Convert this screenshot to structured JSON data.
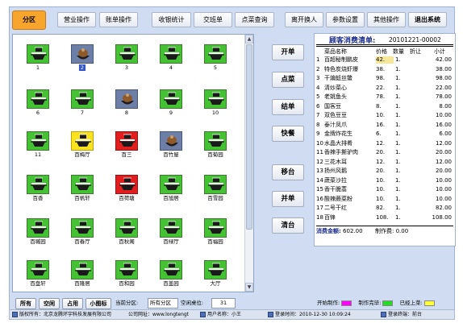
{
  "toolbar": {
    "area_tab": "分区",
    "business_ops": "营业操作",
    "bill_ops": "账单操作",
    "cashier_stats": "收银统计",
    "shift_handover": "交班单",
    "dish_query": "点菜查询",
    "change_user": "离开换人",
    "param_settings": "参数设置",
    "other_ops": "其他操作",
    "exit_system": "退出系统"
  },
  "tables": [
    {
      "label": "1",
      "status": "green"
    },
    {
      "label": "2",
      "status": "blue",
      "selected": true
    },
    {
      "label": "3",
      "status": "green"
    },
    {
      "label": "4",
      "status": "green"
    },
    {
      "label": "5",
      "status": "green"
    },
    {
      "label": "6",
      "status": "green"
    },
    {
      "label": "7",
      "status": "green"
    },
    {
      "label": "8",
      "status": "blue"
    },
    {
      "label": "9",
      "status": "green"
    },
    {
      "label": "10",
      "status": "green"
    },
    {
      "label": "11",
      "status": "green"
    },
    {
      "label": "百梅厅",
      "status": "yellow"
    },
    {
      "label": "百三",
      "status": "red"
    },
    {
      "label": "百竹屋",
      "status": "blue"
    },
    {
      "label": "百菊园",
      "status": "green"
    },
    {
      "label": "百香",
      "status": "green"
    },
    {
      "label": "百帆轩",
      "status": "green"
    },
    {
      "label": "百荷塘",
      "status": "red"
    },
    {
      "label": "百旭居",
      "status": "green"
    },
    {
      "label": "百雪园",
      "status": "green"
    },
    {
      "label": "百嘁园",
      "status": "green"
    },
    {
      "label": "百春厅",
      "status": "green"
    },
    {
      "label": "百秋阁",
      "status": "green"
    },
    {
      "label": "百绿厅",
      "status": "green"
    },
    {
      "label": "百福园",
      "status": "green"
    },
    {
      "label": "百盘轩",
      "status": "green"
    },
    {
      "label": "百隆居",
      "status": "green"
    },
    {
      "label": "百和园",
      "status": "green"
    },
    {
      "label": "百盖园",
      "status": "green"
    },
    {
      "label": "大厅",
      "status": "green"
    }
  ],
  "filter_bar": {
    "all": "所有",
    "empty": "空闲",
    "occupied": "占用",
    "small_icons": "小图标",
    "current_area_label": "当前分区:",
    "current_area_value": "所有分区",
    "table_count_label": "空闲桌位:",
    "table_count_value": "31"
  },
  "actions": {
    "open": "开单",
    "order": "点菜",
    "checkout": "结单",
    "fast_food": "快餐",
    "move_table": "移台",
    "merge_bill": "并单",
    "clear_table": "清台"
  },
  "receipt": {
    "title": "顾客消费清单:",
    "number": "20101221-00002",
    "headers": {
      "name": "菜品名称",
      "price": "价格",
      "qty": "数量",
      "discount": "折让",
      "subtotal": "小计"
    },
    "rows": [
      {
        "no": "1",
        "name": "百超秘制鹏皮",
        "price": "42.",
        "qty": "1.",
        "discount": "",
        "subtotal": "42.00"
      },
      {
        "no": "2",
        "name": "特色炭烧虾爆",
        "price": "38.",
        "qty": "1.",
        "discount": "",
        "subtotal": "38.00"
      },
      {
        "no": "3",
        "name": "干煸蚯丝鳖",
        "price": "98.",
        "qty": "1.",
        "discount": "",
        "subtotal": "98.00"
      },
      {
        "no": "4",
        "name": "清炒菜心",
        "price": "22.",
        "qty": "1.",
        "discount": "",
        "subtotal": "22.00"
      },
      {
        "no": "5",
        "name": "老姚鱼头",
        "price": "78.",
        "qty": "1.",
        "discount": "",
        "subtotal": "78.00"
      },
      {
        "no": "6",
        "name": "国客豆",
        "price": "8.",
        "qty": "1.",
        "discount": "",
        "subtotal": "8.00"
      },
      {
        "no": "7",
        "name": "双色豆豆",
        "price": "10.",
        "qty": "1.",
        "discount": "",
        "subtotal": "10.00"
      },
      {
        "no": "8",
        "name": "泰汁凤爪",
        "price": "16.",
        "qty": "1.",
        "discount": "",
        "subtotal": "16.00"
      },
      {
        "no": "9",
        "name": "金牌炸花生",
        "price": "6.",
        "qty": "1.",
        "discount": "",
        "subtotal": "6.00"
      },
      {
        "no": "10",
        "name": "水晶大排肴",
        "price": "12.",
        "qty": "1.",
        "discount": "",
        "subtotal": "12.00"
      },
      {
        "no": "11",
        "name": "香辣手撕驴肉",
        "price": "20.",
        "qty": "1.",
        "discount": "",
        "subtotal": "20.00"
      },
      {
        "no": "12",
        "name": "三花木耳",
        "price": "12.",
        "qty": "1.",
        "discount": "",
        "subtotal": "12.00"
      },
      {
        "no": "13",
        "name": "扬州风鹅",
        "price": "20.",
        "qty": "1.",
        "discount": "",
        "subtotal": "20.00"
      },
      {
        "no": "14",
        "name": "蔬菜沙拉",
        "price": "10.",
        "qty": "1.",
        "discount": "",
        "subtotal": "10.00"
      },
      {
        "no": "15",
        "name": "香干脆蒿",
        "price": "10.",
        "qty": "1.",
        "discount": "",
        "subtotal": "10.00"
      },
      {
        "no": "16",
        "name": "酸辣蕨菜粉",
        "price": "10.",
        "qty": "1.",
        "discount": "",
        "subtotal": "10.00"
      },
      {
        "no": "17",
        "name": "二号干红",
        "price": "82.",
        "qty": "1.",
        "discount": "",
        "subtotal": "82.00"
      },
      {
        "no": "18",
        "name": "百锋",
        "price": "108.",
        "qty": "1.",
        "discount": "",
        "subtotal": "108.00"
      }
    ],
    "total_label": "消费金额:",
    "total_value": "602.00",
    "paid_label": "制作费:",
    "paid_value": "0.00"
  },
  "legend": {
    "start_label": "开始制作:",
    "start_color": "#ff00ff",
    "done_label": "制作完毕:",
    "done_color": "#22dd22",
    "served_label": "已经上菜:",
    "served_color": "#ffff33"
  },
  "status_bar": {
    "copyright": "版权所有：北京龙腾环宇科技发展有限公司",
    "website": "公司网址：www.longtengt",
    "user": "用户名称：小王",
    "login_time": "登录时间：2010-12-30 10:09:24",
    "terminal": "登录终端：前台"
  }
}
